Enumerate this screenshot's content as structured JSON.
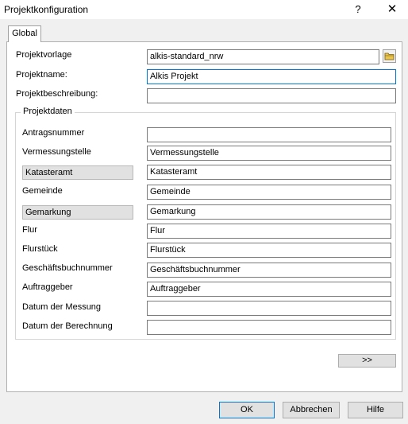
{
  "window": {
    "title": "Projektkonfiguration",
    "help_label": "?",
    "close_label": "✕"
  },
  "tabs": [
    {
      "label": "Global",
      "active": true
    }
  ],
  "project": {
    "vorlage": {
      "label": "Projektvorlage",
      "value": "alkis-standard_nrw"
    },
    "name": {
      "label": "Projektname:",
      "value": "Alkis Projekt"
    },
    "beschreibung": {
      "label": "Projektbeschreibung:",
      "value": ""
    },
    "browse_icon": "folder-icon"
  },
  "projektdaten": {
    "title": "Projektdaten",
    "fields": [
      {
        "label": "Antragsnummer",
        "value": ""
      },
      {
        "label": "Vermessungstelle",
        "value": "Vermessungstelle"
      },
      {
        "label": "Katasteramt",
        "value": "Katasteramt"
      },
      {
        "label": "Gemeinde",
        "value": "Gemeinde"
      },
      {
        "label": "Gemarkung",
        "value": "Gemarkung"
      },
      {
        "label": "Flur",
        "value": "Flur"
      },
      {
        "label": "Flurstück",
        "value": "Flurstück"
      },
      {
        "label": "Geschäftsbuchnummer",
        "value": "Geschäftsbuchnummer"
      },
      {
        "label": "Auftraggeber",
        "value": "Auftraggeber"
      },
      {
        "label": "Datum der Messung",
        "value": ""
      },
      {
        "label": "Datum der Berechnung",
        "value": ""
      }
    ]
  },
  "buttons": {
    "more": ">>",
    "ok": "OK",
    "cancel": "Abbrechen",
    "help": "Hilfe"
  },
  "colors": {
    "focus_border": "#0078d7",
    "dialog_bg": "#f0f0f0",
    "label_box_bg": "#e1e1e1"
  }
}
